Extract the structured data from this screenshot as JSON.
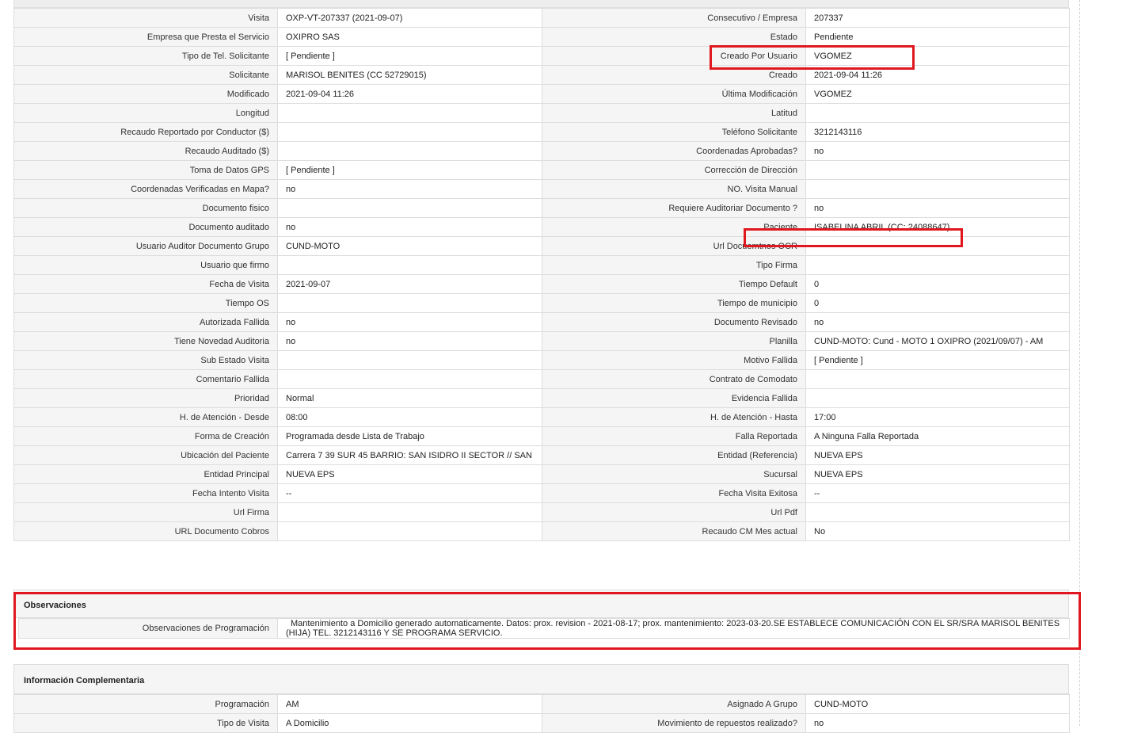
{
  "main_rows": [
    [
      {
        "label": "Visita",
        "value": "OXP-VT-207337 (2021-09-07)"
      },
      {
        "label": "Consecutivo / Empresa",
        "value": "207337"
      }
    ],
    [
      {
        "label": "Empresa que Presta el Servicio",
        "value": "OXIPRO SAS"
      },
      {
        "label": "Estado",
        "value": "Pendiente"
      }
    ],
    [
      {
        "label": "Tipo de Tel. Solicitante",
        "value": "[ Pendiente ]"
      },
      {
        "label": "Creado Por Usuario",
        "value": "VGOMEZ"
      }
    ],
    [
      {
        "label": "Solicitante",
        "value": "MARISOL BENITES (CC 52729015)"
      },
      {
        "label": "Creado",
        "value": "2021-09-04 11:26"
      }
    ],
    [
      {
        "label": "Modificado",
        "value": "2021-09-04 11:26"
      },
      {
        "label": "Última Modificación",
        "value": " VGOMEZ"
      }
    ],
    [
      {
        "label": "Longitud",
        "value": ""
      },
      {
        "label": "Latitud",
        "value": ""
      }
    ],
    [
      {
        "label": "Recaudo Reportado por Conductor ($)",
        "value": ""
      },
      {
        "label": "Teléfono Solicitante",
        "value": "3212143116"
      }
    ],
    [
      {
        "label": "Recaudo Auditado ($)",
        "value": ""
      },
      {
        "label": "Coordenadas Aprobadas?",
        "value": " no"
      }
    ],
    [
      {
        "label": "Toma de Datos GPS",
        "value": "[ Pendiente ]"
      },
      {
        "label": "Corrección de Dirección",
        "value": ""
      }
    ],
    [
      {
        "label": "Coordenadas Verificadas en Mapa?",
        "value": " no"
      },
      {
        "label": "NO. Visita Manual",
        "value": ""
      }
    ],
    [
      {
        "label": "Documento fisico",
        "value": ""
      },
      {
        "label": "Requiere Auditoriar Documento ?",
        "value": " no"
      }
    ],
    [
      {
        "label": "Documento auditado",
        "value": " no"
      },
      {
        "label": "Paciente",
        "value": "ISABELINA ABRIL (CC: 24088647)"
      }
    ],
    [
      {
        "label": "Usuario Auditor Documento Grupo",
        "value": "CUND-MOTO"
      },
      {
        "label": "Url Docuemtnos OCR",
        "value": ""
      }
    ],
    [
      {
        "label": "Usuario que firmo",
        "value": ""
      },
      {
        "label": "Tipo Firma",
        "value": ""
      }
    ],
    [
      {
        "label": "Fecha de Visita",
        "value": " 2021-09-07"
      },
      {
        "label": "Tiempo Default",
        "value": "0"
      }
    ],
    [
      {
        "label": "Tiempo OS",
        "value": ""
      },
      {
        "label": "Tiempo de municipio",
        "value": "0"
      }
    ],
    [
      {
        "label": "Autorizada Fallida",
        "value": " no"
      },
      {
        "label": "Documento Revisado",
        "value": " no"
      }
    ],
    [
      {
        "label": "Tiene Novedad Auditoria",
        "value": " no"
      },
      {
        "label": "Planilla",
        "value": "CUND-MOTO: Cund - MOTO 1 OXIPRO (2021/09/07) - AM"
      }
    ],
    [
      {
        "label": "Sub Estado Visita",
        "value": ""
      },
      {
        "label": "Motivo Fallida",
        "value": "[ Pendiente ]"
      }
    ],
    [
      {
        "label": "Comentario Fallida",
        "value": ""
      },
      {
        "label": "Contrato de Comodato",
        "value": ""
      }
    ],
    [
      {
        "label": "Prioridad",
        "value": "Normal"
      },
      {
        "label": "Evidencia Fallida",
        "value": ""
      }
    ],
    [
      {
        "label": "H. de Atención - Desde",
        "value": "08:00"
      },
      {
        "label": "H. de Atención - Hasta",
        "value": "17:00"
      }
    ],
    [
      {
        "label": "Forma de Creación",
        "value": "Programada desde Lista de Trabajo"
      },
      {
        "label": "Falla Reportada",
        "value": "A Ninguna Falla Reportada"
      }
    ],
    [
      {
        "label": "Ubicación del Paciente",
        "value": "Carrera 7 39 SUR 45 BARRIO: SAN ISIDRO II SECTOR // SAN"
      },
      {
        "label": "Entidad (Referencia)",
        "value": "NUEVA EPS"
      }
    ],
    [
      {
        "label": "Entidad Principal",
        "value": "NUEVA EPS"
      },
      {
        "label": "Sucursal",
        "value": "NUEVA EPS"
      }
    ],
    [
      {
        "label": "Fecha Intento Visita",
        "value": "--"
      },
      {
        "label": "Fecha Visita Exitosa",
        "value": " --"
      }
    ],
    [
      {
        "label": "Url Firma",
        "value": ""
      },
      {
        "label": "Url Pdf",
        "value": ""
      }
    ],
    [
      {
        "label": "URL Documento Cobros",
        "value": ""
      },
      {
        "label": "Recaudo CM Mes actual",
        "value": "No"
      }
    ]
  ],
  "observaciones": {
    "title": "Observaciones",
    "label": "Observaciones de Programación",
    "value_line1": "Mantenimiento a Domicilio generado automaticamente. Datos: prox. revision - 2021-08-17; prox. mantenimiento: 2023-03-20.SE ESTABLECE COMUNICACIÓN CON EL SR/SRA MARISOL BENITES",
    "value_line2": "(HIJA) TEL. 3212143116 Y SE PROGRAMA SERVICIO."
  },
  "info_complementaria": {
    "title": "Información Complementaria",
    "rows": [
      [
        {
          "label": "Programación",
          "value": "AM"
        },
        {
          "label": "Asignado A Grupo",
          "value": "CUND-MOTO"
        }
      ],
      [
        {
          "label": "Tipo de Visita",
          "value": "A Domicilio"
        },
        {
          "label": "Movimiento de repuestos realizado?",
          "value": " no"
        }
      ]
    ]
  },
  "colors": {
    "highlight": "#e0171f",
    "label_bg": "#f5f5f5",
    "border": "#dddddd"
  }
}
